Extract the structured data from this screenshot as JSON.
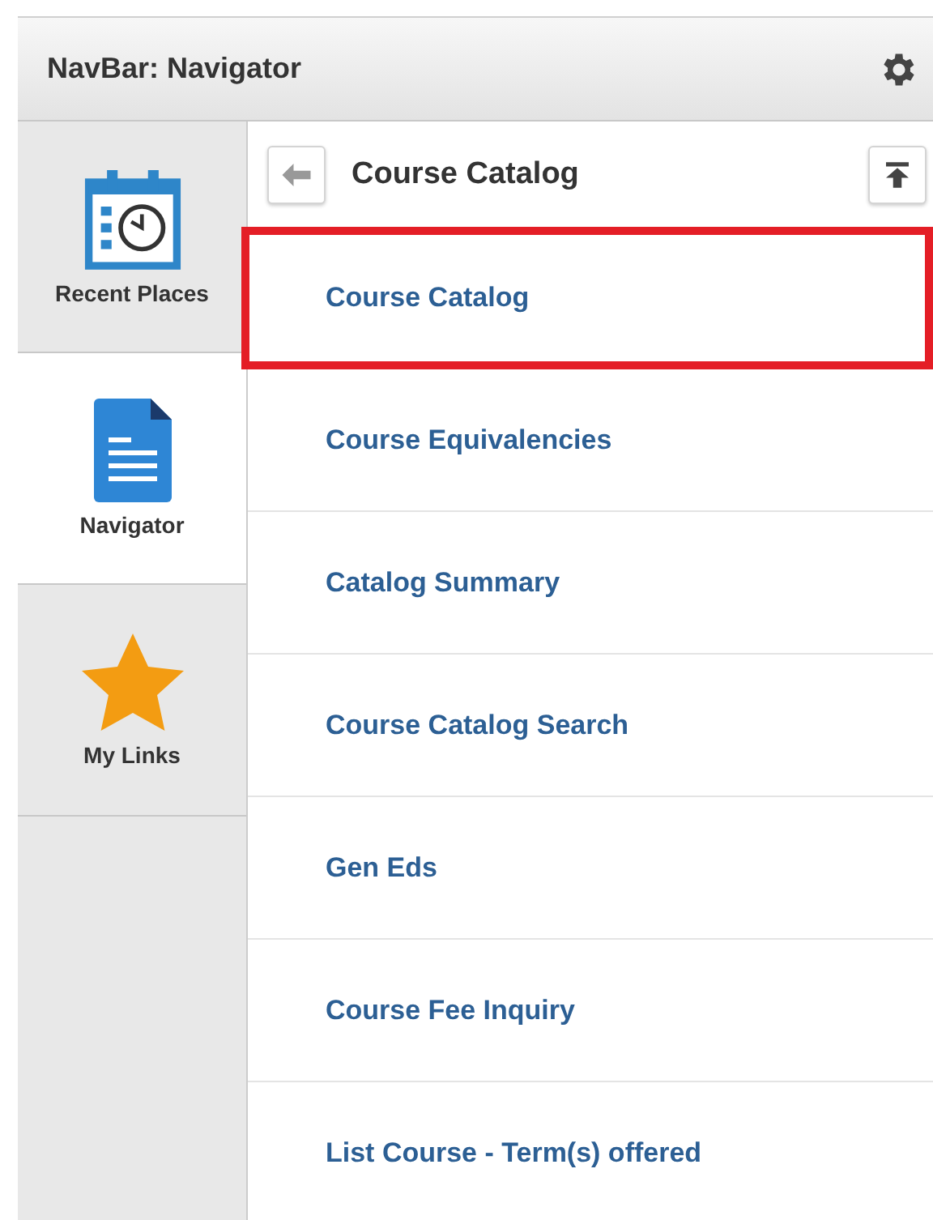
{
  "navbar": {
    "title": "NavBar: Navigator"
  },
  "tabs": [
    {
      "label": "Recent Places",
      "kind": "calendar",
      "selected": false
    },
    {
      "label": "Navigator",
      "kind": "document",
      "selected": true
    },
    {
      "label": "My Links",
      "kind": "star",
      "selected": false
    }
  ],
  "panel": {
    "title": "Course Catalog"
  },
  "items": [
    {
      "label": "Course Catalog",
      "highlighted": true
    },
    {
      "label": "Course Equivalencies",
      "highlighted": false
    },
    {
      "label": "Catalog Summary",
      "highlighted": false
    },
    {
      "label": "Course Catalog Search",
      "highlighted": false
    },
    {
      "label": "Gen Eds",
      "highlighted": false
    },
    {
      "label": "Course Fee Inquiry",
      "highlighted": false
    },
    {
      "label": "List Course - Term(s) offered",
      "highlighted": false
    }
  ]
}
